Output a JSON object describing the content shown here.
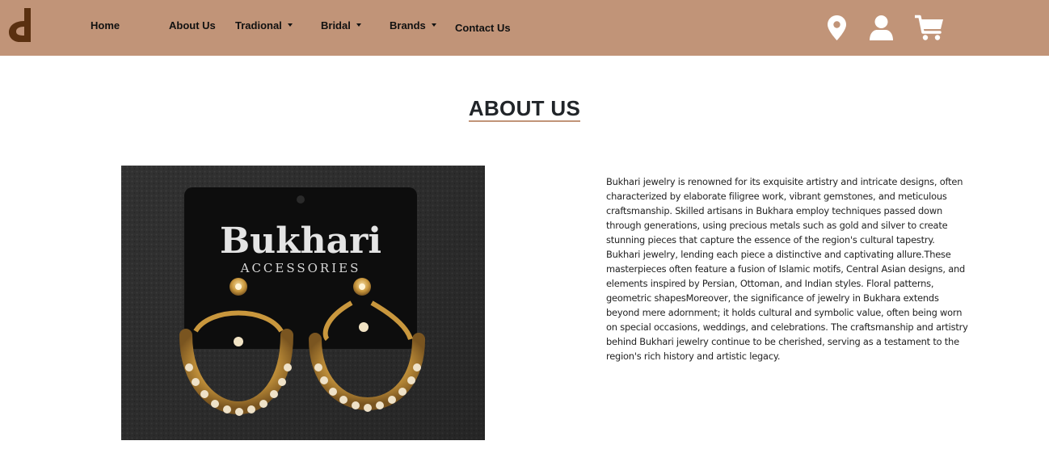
{
  "navbar": {
    "logo_icon": "brand-logo-icon",
    "home_label": "Home",
    "about_label": "About Us",
    "traditional_label": "Tradional",
    "bridal_label": "Bridal",
    "brands_label": "Brands",
    "contact_label": "Contact Us",
    "icons": [
      "location-pin-icon",
      "user-icon",
      "cart-icon"
    ],
    "background_color": "#c19478"
  },
  "main": {
    "title": "ABOUT US",
    "photo": {
      "brand_text": "Bukhari",
      "brand_subtext": "ACCESSORIES"
    },
    "paragraph": "Bukhari jewelry is renowned for its exquisite artistry and intricate designs, often characterized by elaborate filigree work, vibrant gemstones, and meticulous craftsmanship. Skilled artisans in Bukhara employ techniques passed down through generations, using precious metals such as gold and silver to create stunning pieces that capture the essence of the region's cultural tapestry. Bukhari jewelry, lending each piece a distinctive and captivating allure.These masterpieces often feature a fusion of Islamic motifs, Central Asian designs, and elements inspired by Persian, Ottoman, and Indian styles. Floral patterns, geometric shapesMoreover, the significance of jewelry in Bukhara extends beyond mere adornment; it holds cultural and symbolic value, often being worn on special occasions, weddings, and celebrations. The craftsmanship and artistry behind Bukhari jewelry continue to be cherished, serving as a testament to the region's rich history and artistic legacy."
  }
}
